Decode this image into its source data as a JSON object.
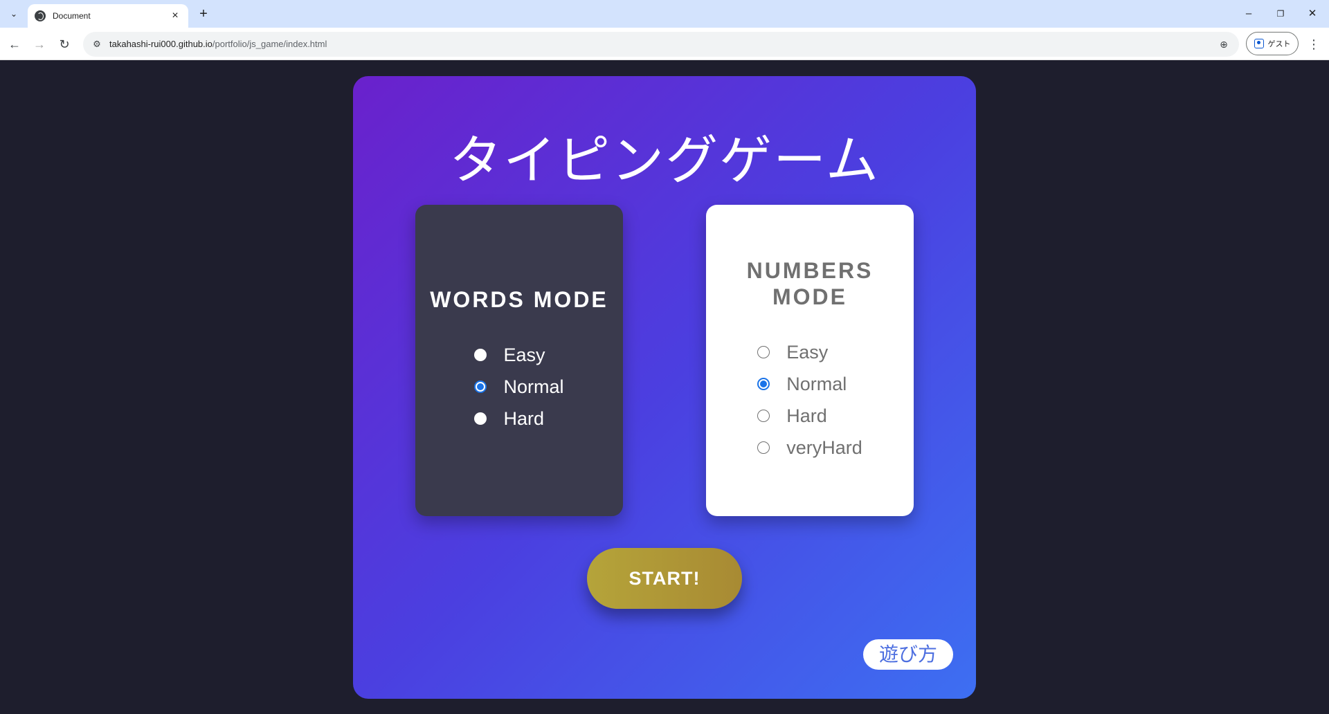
{
  "browser": {
    "tab": {
      "title": "Document",
      "close": "×"
    },
    "new_tab": "+",
    "window_controls": {
      "minimize": "–",
      "restore": "❐",
      "close": "✕"
    },
    "nav": {
      "back": "←",
      "forward": "→",
      "reload": "↻"
    },
    "url": {
      "host": "takahashi-rui000.github.io",
      "path": "/portfolio/js_game/index.html"
    },
    "profile_label": "ゲスト",
    "menu": "⋮",
    "icons": [
      "tab-search-icon",
      "globe-icon",
      "site-info-icon",
      "zoom-icon",
      "profile-icon"
    ]
  },
  "game": {
    "title": "タイピングゲーム",
    "words_mode": {
      "title": "WORDS MODE",
      "options": [
        {
          "label": "Easy",
          "checked": false
        },
        {
          "label": "Normal",
          "checked": true
        },
        {
          "label": "Hard",
          "checked": false
        }
      ]
    },
    "numbers_mode": {
      "title": "NUMBERS MODE",
      "options": [
        {
          "label": "Easy",
          "checked": false
        },
        {
          "label": "Normal",
          "checked": true
        },
        {
          "label": "Hard",
          "checked": false
        },
        {
          "label": "veryHard",
          "checked": false
        }
      ]
    },
    "start_label": "START!",
    "howto_label": "遊び方",
    "colors": {
      "background": "#1e1e2d",
      "gradient_start": "#6a21cc",
      "gradient_end": "#3d6ff2",
      "words_card": "#3a3a4d",
      "numbers_card": "#ffffff",
      "start_button": "#b5a43a",
      "radio_checked": "#1a73e8"
    }
  }
}
